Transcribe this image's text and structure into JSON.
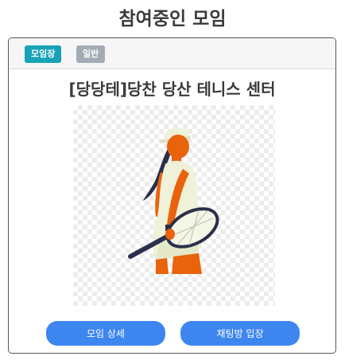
{
  "page": {
    "title": "참여중인 모임"
  },
  "card": {
    "badges": {
      "role": "모임장",
      "type": "일반"
    },
    "club_title": "[당당테]당찬 당산 테니스 센터",
    "image_icon": "tennis-player-illustration"
  },
  "buttons": {
    "detail_label": "모임 상세",
    "chat_label": "채팅방 입장"
  },
  "colors": {
    "badge_role": "#17a2b8",
    "badge_type": "#a3acb4",
    "primary_button": "#3d86f0",
    "skin": "#e8630c",
    "dress": "#eff1d8"
  }
}
